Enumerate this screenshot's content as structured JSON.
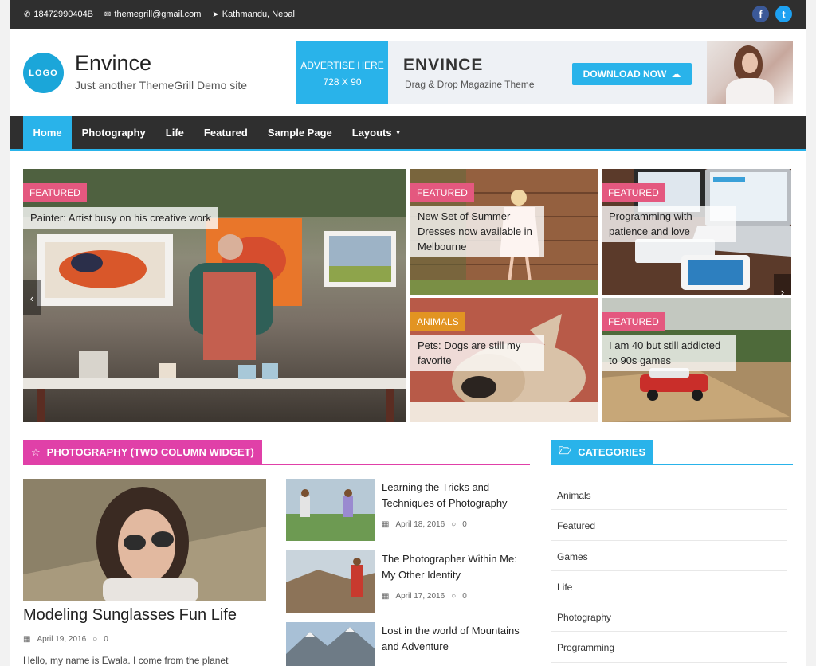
{
  "topbar": {
    "phone": "18472990404B",
    "email": "themegrill@gmail.com",
    "location": "Kathmandu, Nepal",
    "social": [
      "facebook-icon",
      "twitter-icon"
    ],
    "facebook_glyph": "f",
    "twitter_glyph": "t"
  },
  "header": {
    "logo_text": "LOGO",
    "site_title": "Envince",
    "tagline": "Just another ThemeGrill Demo site"
  },
  "ad": {
    "advertise_line1": "ADVERTISE HERE",
    "advertise_line2": "728 X 90",
    "brand": "ENVINCE",
    "subtitle": "Drag & Drop Magazine Theme",
    "button": "DOWNLOAD NOW"
  },
  "nav": {
    "items": [
      "Home",
      "Photography",
      "Life",
      "Featured",
      "Sample Page",
      "Layouts"
    ],
    "active": "Home"
  },
  "slider": {
    "main": {
      "tag": "FEATURED",
      "title": "Painter: Artist busy on his creative work"
    },
    "tiles": [
      {
        "tag": "FEATURED",
        "title": "New Set of Summer Dresses now available in Melbourne"
      },
      {
        "tag": "FEATURED",
        "title": "Programming with patience and love"
      },
      {
        "tag": "ANIMALS",
        "title": "Pets: Dogs are still my favorite"
      },
      {
        "tag": "FEATURED",
        "title": "I am 40 but still addicted to 90s games"
      }
    ],
    "prev": "‹",
    "next": "›"
  },
  "photography_widget": {
    "title": "PHOTOGRAPHY (TWO COLUMN WIDGET)",
    "featured": {
      "title": "Modeling Sunglasses Fun Life",
      "date": "April 19, 2016",
      "comments": "0",
      "excerpt": "Hello, my name is Ewala. I come from the planet"
    },
    "posts": [
      {
        "title": "Learning the Tricks and Techniques of Photography",
        "date": "April 18, 2016",
        "comments": "0"
      },
      {
        "title": "The Photographer Within Me: My Other Identity",
        "date": "April 17, 2016",
        "comments": "0"
      },
      {
        "title": "Lost in the world of Mountains and Adventure",
        "date": "",
        "comments": ""
      }
    ]
  },
  "categories_widget": {
    "title": "CATEGORIES",
    "items": [
      "Animals",
      "Featured",
      "Games",
      "Life",
      "Photography",
      "Programming"
    ]
  },
  "colors": {
    "accent_blue": "#29b3ea",
    "accent_pink": "#e040a8",
    "tag_pink": "#e4587f",
    "tag_orange": "#e29422",
    "dark_bar": "#2f2f2f"
  }
}
